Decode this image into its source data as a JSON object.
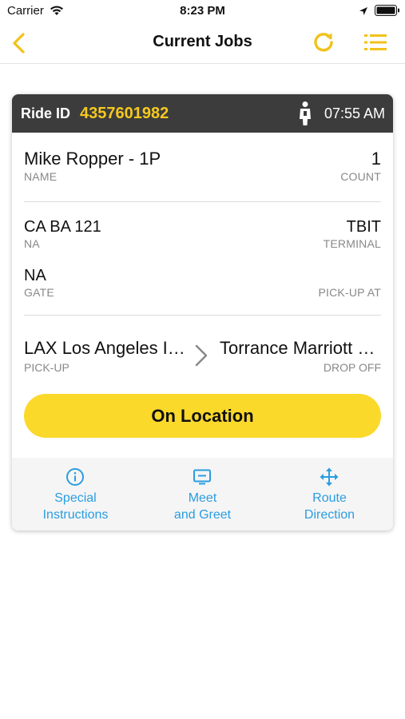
{
  "status_bar": {
    "carrier": "Carrier",
    "time": "8:23 PM"
  },
  "nav": {
    "title": "Current Jobs"
  },
  "ride": {
    "id_label": "Ride ID",
    "id": "4357601982",
    "time": "07:55 AM"
  },
  "passenger": {
    "name": "Mike  Ropper - 1P",
    "name_label": "NAME",
    "count": "1",
    "count_label": "COUNT"
  },
  "flight": {
    "number": "CA BA 121",
    "number_label": "NA",
    "terminal": "TBIT",
    "terminal_label": "TERMINAL",
    "gate": "NA",
    "gate_label": "GATE",
    "pickup_at_label": "PICK-UP AT"
  },
  "route": {
    "pickup": "LAX Los Angeles International Airport",
    "pickup_label": "PICK-UP",
    "dropoff": "Torrance Marriott Redondo Beach",
    "dropoff_label": "DROP OFF"
  },
  "primary_action": {
    "label": "On Location"
  },
  "actions": [
    {
      "icon": "info-icon",
      "line1": "Special",
      "line2": "Instructions"
    },
    {
      "icon": "monitor-icon",
      "line1": "Meet",
      "line2": "and Greet"
    },
    {
      "icon": "move-arrows-icon",
      "line1": "Route",
      "line2": "Direction"
    }
  ],
  "colors": {
    "accent_yellow": "#fbd92b",
    "ride_id_yellow": "#f6c91e",
    "nav_icon_yellow": "#f2c21b",
    "header_dark": "#3c3c3c",
    "link_blue": "#2a9de1"
  }
}
